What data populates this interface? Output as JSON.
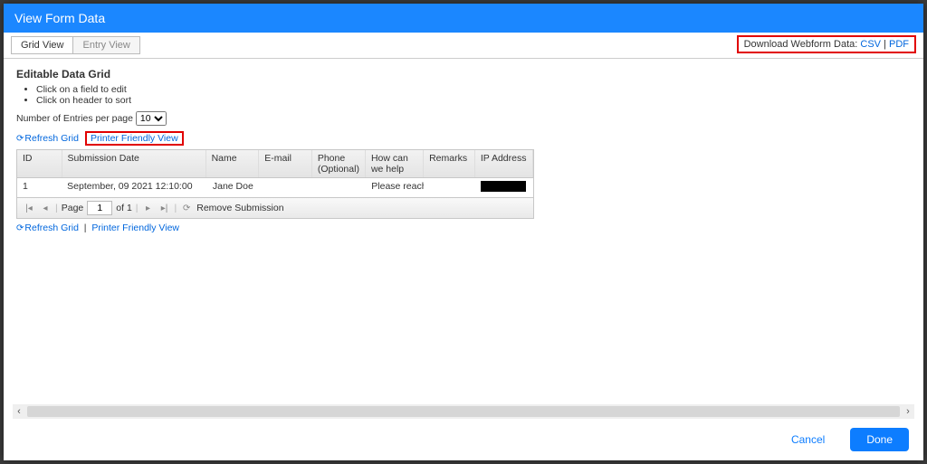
{
  "header": {
    "title": "View Form Data"
  },
  "tabs": {
    "grid": "Grid View",
    "entry": "Entry View"
  },
  "download": {
    "label": "Download Webform Data:",
    "csv": "CSV",
    "pdf": "PDF",
    "sep": " | "
  },
  "gridTitle": "Editable Data Grid",
  "hints": [
    "Click on a field to edit",
    "Click on header to sort"
  ],
  "entriesLabel": "Number of Entries per page",
  "entriesValue": "10",
  "refresh": "Refresh Grid",
  "printerFriendly": "Printer Friendly View",
  "columns": {
    "id": "ID",
    "date": "Submission Date",
    "name": "Name",
    "email": "E-mail",
    "phone": "Phone (Optional)",
    "help": "How can we help",
    "remarks": "Remarks",
    "ip": "IP Address"
  },
  "rows": [
    {
      "id": "1",
      "date": "September, 09 2021 12:10:00",
      "name": "Jane Doe",
      "email": "",
      "phone": "",
      "help": "Please reach ...",
      "remarks": "",
      "ip": ""
    }
  ],
  "pager": {
    "pageLabel": "Page",
    "page": "1",
    "ofLabel": "of 1",
    "remove": "Remove Submission"
  },
  "footer": {
    "cancel": "Cancel",
    "done": "Done"
  }
}
